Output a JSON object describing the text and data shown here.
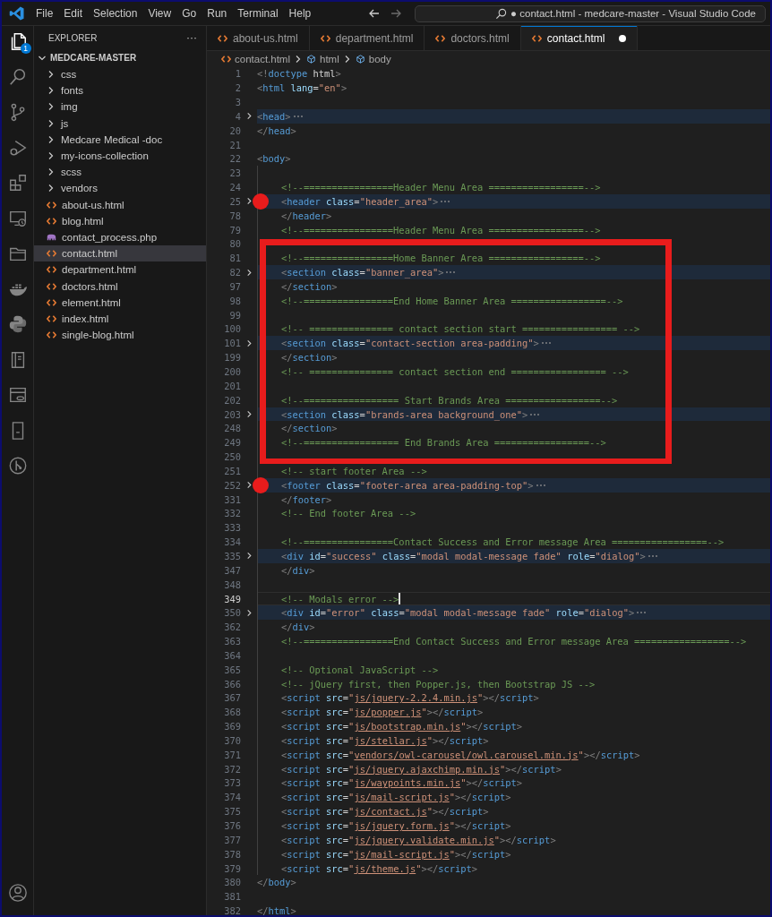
{
  "title_bar": {
    "menu": [
      "File",
      "Edit",
      "Selection",
      "View",
      "Go",
      "Run",
      "Terminal",
      "Help"
    ],
    "command_center": "● contact.html - medcare-master - Visual Studio Code"
  },
  "activity_bar": {
    "items": [
      {
        "kind": "explorer",
        "selected": true,
        "badge": "1"
      },
      {
        "kind": "search",
        "selected": false
      },
      {
        "kind": "source-control",
        "selected": false
      },
      {
        "kind": "run-debug",
        "selected": false
      },
      {
        "kind": "extensions",
        "selected": false
      },
      {
        "kind": "remote",
        "selected": false
      },
      {
        "kind": "folder",
        "selected": false
      },
      {
        "kind": "docker",
        "selected": false
      },
      {
        "kind": "python",
        "selected": false
      },
      {
        "kind": "book",
        "selected": false
      },
      {
        "kind": "database",
        "selected": false
      },
      {
        "kind": "bookmark",
        "selected": false
      },
      {
        "kind": "git-graph",
        "selected": false
      }
    ],
    "bottom": [
      {
        "kind": "account",
        "selected": false
      }
    ]
  },
  "sidebar": {
    "title": "EXPLORER",
    "more": "···",
    "root": {
      "label": "MEDCARE-MASTER",
      "expanded": true,
      "children": [
        {
          "kind": "folder",
          "label": "css",
          "expanded": false,
          "selected": false
        },
        {
          "kind": "folder",
          "label": "fonts",
          "expanded": false,
          "selected": false
        },
        {
          "kind": "folder",
          "label": "img",
          "expanded": false,
          "selected": false
        },
        {
          "kind": "folder",
          "label": "js",
          "expanded": false,
          "selected": false
        },
        {
          "kind": "folder",
          "label": "Medcare Medical -doc",
          "expanded": false,
          "selected": false
        },
        {
          "kind": "folder",
          "label": "my-icons-collection",
          "expanded": false,
          "selected": false
        },
        {
          "kind": "folder",
          "label": "scss",
          "expanded": false,
          "selected": false
        },
        {
          "kind": "folder",
          "label": "vendors",
          "expanded": false,
          "selected": false
        },
        {
          "kind": "html",
          "label": "about-us.html",
          "selected": false
        },
        {
          "kind": "html",
          "label": "blog.html",
          "selected": false
        },
        {
          "kind": "php",
          "label": "contact_process.php",
          "selected": false
        },
        {
          "kind": "html",
          "label": "contact.html",
          "selected": true
        },
        {
          "kind": "html",
          "label": "department.html",
          "selected": false
        },
        {
          "kind": "html",
          "label": "doctors.html",
          "selected": false
        },
        {
          "kind": "html",
          "label": "element.html",
          "selected": false
        },
        {
          "kind": "html",
          "label": "index.html",
          "selected": false
        },
        {
          "kind": "html",
          "label": "single-blog.html",
          "selected": false
        }
      ]
    }
  },
  "tabs": [
    {
      "label": "about-us.html",
      "selected": false,
      "modified": false
    },
    {
      "label": "department.html",
      "selected": false,
      "modified": false
    },
    {
      "label": "doctors.html",
      "selected": false,
      "modified": false
    },
    {
      "label": "contact.html",
      "selected": true,
      "modified": true
    }
  ],
  "breadcrumbs": [
    {
      "kind": "file",
      "label": "contact.html"
    },
    {
      "kind": "element",
      "label": "html"
    },
    {
      "kind": "element",
      "label": "body"
    }
  ],
  "editor": {
    "segments": [
      {
        "annotated": false,
        "lines": [
          {
            "number": "1",
            "indented": false,
            "folded": false,
            "tokens": [
              {
                "kind": "punct",
                "text": "<!"
              },
              {
                "kind": "tag",
                "text": "doctype"
              },
              {
                "kind": "plain",
                "text": " html"
              },
              {
                "kind": "punct",
                "text": ">"
              }
            ]
          },
          {
            "number": "2",
            "indented": false,
            "folded": false,
            "tokens": [
              {
                "kind": "punct",
                "text": "<"
              },
              {
                "kind": "tag",
                "text": "html"
              },
              {
                "kind": "attr",
                "text": " lang"
              },
              {
                "kind": "plain",
                "text": "="
              },
              {
                "kind": "string",
                "text": "\"en\""
              },
              {
                "kind": "punct",
                "text": ">"
              }
            ]
          },
          {
            "number": "3",
            "indented": false,
            "folded": false
          },
          {
            "number": "4",
            "indented": false,
            "folded": true,
            "tokens": [
              {
                "kind": "punct",
                "text": "<"
              },
              {
                "kind": "tag",
                "text": "head"
              },
              {
                "kind": "punct",
                "text": ">"
              }
            ]
          },
          {
            "number": "20",
            "indented": false,
            "folded": false,
            "tokens": [
              {
                "kind": "punct",
                "text": "</"
              },
              {
                "kind": "tag",
                "text": "head"
              },
              {
                "kind": "punct",
                "text": ">"
              }
            ]
          },
          {
            "number": "21",
            "indented": false,
            "folded": false
          },
          {
            "number": "22",
            "indented": false,
            "folded": false,
            "tokens": [
              {
                "kind": "punct",
                "text": "<"
              },
              {
                "kind": "tag",
                "text": "body"
              },
              {
                "kind": "punct",
                "text": ">"
              }
            ]
          },
          {
            "number": "23",
            "indented": true,
            "folded": false
          },
          {
            "number": "24",
            "indented": true,
            "folded": false,
            "tokens": [
              {
                "kind": "comment",
                "text": "<!--================Header Menu Area =================-->"
              }
            ]
          },
          {
            "number": "25",
            "indented": true,
            "folded": true,
            "breakpoint": true,
            "tokens": [
              {
                "kind": "punct",
                "text": "<"
              },
              {
                "kind": "tag",
                "text": "header"
              },
              {
                "kind": "attr",
                "text": " class"
              },
              {
                "kind": "plain",
                "text": "="
              },
              {
                "kind": "string",
                "text": "\"header_area\""
              },
              {
                "kind": "punct",
                "text": ">"
              }
            ]
          },
          {
            "number": "78",
            "indented": true,
            "folded": false,
            "tokens": [
              {
                "kind": "punct",
                "text": "</"
              },
              {
                "kind": "tag",
                "text": "header"
              },
              {
                "kind": "punct",
                "text": ">"
              }
            ]
          },
          {
            "number": "79",
            "indented": true,
            "folded": false,
            "tokens": [
              {
                "kind": "comment",
                "text": "<!--================Header Menu Area =================-->"
              }
            ]
          }
        ]
      },
      {
        "annotated": true,
        "lines": [
          {
            "number": "80",
            "indented": true,
            "folded": false
          },
          {
            "number": "81",
            "indented": true,
            "folded": false,
            "tokens": [
              {
                "kind": "comment",
                "text": "<!--================Home Banner Area =================-->"
              }
            ]
          },
          {
            "number": "82",
            "indented": true,
            "folded": true,
            "tokens": [
              {
                "kind": "punct",
                "text": "<"
              },
              {
                "kind": "tag",
                "text": "section"
              },
              {
                "kind": "attr",
                "text": " class"
              },
              {
                "kind": "plain",
                "text": "="
              },
              {
                "kind": "string",
                "text": "\"banner_area\""
              },
              {
                "kind": "punct",
                "text": ">"
              }
            ]
          },
          {
            "number": "97",
            "indented": true,
            "folded": false,
            "tokens": [
              {
                "kind": "punct",
                "text": "</"
              },
              {
                "kind": "tag",
                "text": "section"
              },
              {
                "kind": "punct",
                "text": ">"
              }
            ]
          },
          {
            "number": "98",
            "indented": true,
            "folded": false,
            "tokens": [
              {
                "kind": "comment",
                "text": "<!--================End Home Banner Area =================-->"
              }
            ]
          },
          {
            "number": "99",
            "indented": true,
            "folded": false
          },
          {
            "number": "100",
            "indented": true,
            "folded": false,
            "tokens": [
              {
                "kind": "comment",
                "text": "<!-- =============== contact section start ================= -->"
              }
            ]
          },
          {
            "number": "101",
            "indented": true,
            "folded": true,
            "tokens": [
              {
                "kind": "punct",
                "text": "<"
              },
              {
                "kind": "tag",
                "text": "section"
              },
              {
                "kind": "attr",
                "text": " class"
              },
              {
                "kind": "plain",
                "text": "="
              },
              {
                "kind": "string",
                "text": "\"contact-section area-padding\""
              },
              {
                "kind": "punct",
                "text": ">"
              }
            ]
          },
          {
            "number": "199",
            "indented": true,
            "folded": false,
            "tokens": [
              {
                "kind": "punct",
                "text": "</"
              },
              {
                "kind": "tag",
                "text": "section"
              },
              {
                "kind": "punct",
                "text": ">"
              }
            ]
          },
          {
            "number": "200",
            "indented": true,
            "folded": false,
            "tokens": [
              {
                "kind": "comment",
                "text": "<!-- =============== contact section end ================= -->"
              }
            ]
          },
          {
            "number": "201",
            "indented": true,
            "folded": false
          },
          {
            "number": "202",
            "indented": true,
            "folded": false,
            "tokens": [
              {
                "kind": "comment",
                "text": "<!--================= Start Brands Area =================-->"
              }
            ]
          },
          {
            "number": "203",
            "indented": true,
            "folded": true,
            "tokens": [
              {
                "kind": "punct",
                "text": "<"
              },
              {
                "kind": "tag",
                "text": "section"
              },
              {
                "kind": "attr",
                "text": " class"
              },
              {
                "kind": "plain",
                "text": "="
              },
              {
                "kind": "string",
                "text": "\"brands-area background_one\""
              },
              {
                "kind": "punct",
                "text": ">"
              }
            ]
          },
          {
            "number": "248",
            "indented": true,
            "folded": false,
            "tokens": [
              {
                "kind": "punct",
                "text": "</"
              },
              {
                "kind": "tag",
                "text": "section"
              },
              {
                "kind": "punct",
                "text": ">"
              }
            ]
          },
          {
            "number": "249",
            "indented": true,
            "folded": false,
            "tokens": [
              {
                "kind": "comment",
                "text": "<!--================= End Brands Area =================-->"
              }
            ]
          },
          {
            "number": "250",
            "indented": true,
            "folded": false
          }
        ]
      },
      {
        "annotated": false,
        "lines": [
          {
            "number": "251",
            "indented": true,
            "folded": false,
            "tokens": [
              {
                "kind": "comment",
                "text": "<!-- start footer Area -->"
              }
            ]
          },
          {
            "number": "252",
            "indented": true,
            "folded": true,
            "breakpoint": true,
            "tokens": [
              {
                "kind": "punct",
                "text": "<"
              },
              {
                "kind": "tag",
                "text": "footer"
              },
              {
                "kind": "attr",
                "text": " class"
              },
              {
                "kind": "plain",
                "text": "="
              },
              {
                "kind": "string",
                "text": "\"footer-area area-padding-top\""
              },
              {
                "kind": "punct",
                "text": ">"
              }
            ]
          },
          {
            "number": "331",
            "indented": true,
            "folded": false,
            "tokens": [
              {
                "kind": "punct",
                "text": "</"
              },
              {
                "kind": "tag",
                "text": "footer"
              },
              {
                "kind": "punct",
                "text": ">"
              }
            ]
          },
          {
            "number": "332",
            "indented": true,
            "folded": false,
            "tokens": [
              {
                "kind": "comment",
                "text": "<!-- End footer Area -->"
              }
            ]
          },
          {
            "number": "333",
            "indented": true,
            "folded": false
          },
          {
            "number": "334",
            "indented": true,
            "folded": false,
            "tokens": [
              {
                "kind": "comment",
                "text": "<!--================Contact Success and Error message Area =================-->"
              }
            ]
          },
          {
            "number": "335",
            "indented": true,
            "folded": true,
            "tokens": [
              {
                "kind": "punct",
                "text": "<"
              },
              {
                "kind": "tag",
                "text": "div"
              },
              {
                "kind": "attr",
                "text": " id"
              },
              {
                "kind": "plain",
                "text": "="
              },
              {
                "kind": "string",
                "text": "\"success\""
              },
              {
                "kind": "attr",
                "text": " class"
              },
              {
                "kind": "plain",
                "text": "="
              },
              {
                "kind": "string",
                "text": "\"modal modal-message fade\""
              },
              {
                "kind": "attr",
                "text": " role"
              },
              {
                "kind": "plain",
                "text": "="
              },
              {
                "kind": "string",
                "text": "\"dialog\""
              },
              {
                "kind": "punct",
                "text": ">"
              }
            ]
          },
          {
            "number": "347",
            "indented": true,
            "folded": false,
            "tokens": [
              {
                "kind": "punct",
                "text": "</"
              },
              {
                "kind": "tag",
                "text": "div"
              },
              {
                "kind": "punct",
                "text": ">"
              }
            ]
          },
          {
            "number": "348",
            "indented": true,
            "folded": false
          },
          {
            "number": "349",
            "indented": true,
            "folded": false,
            "current": true,
            "tokens": [
              {
                "kind": "comment",
                "text": "<!-- Modals error -->"
              }
            ]
          },
          {
            "number": "350",
            "indented": true,
            "folded": true,
            "tokens": [
              {
                "kind": "punct",
                "text": "<"
              },
              {
                "kind": "tag",
                "text": "div"
              },
              {
                "kind": "attr",
                "text": " id"
              },
              {
                "kind": "plain",
                "text": "="
              },
              {
                "kind": "string",
                "text": "\"error\""
              },
              {
                "kind": "attr",
                "text": " class"
              },
              {
                "kind": "plain",
                "text": "="
              },
              {
                "kind": "string",
                "text": "\"modal modal-message fade\""
              },
              {
                "kind": "attr",
                "text": " role"
              },
              {
                "kind": "plain",
                "text": "="
              },
              {
                "kind": "string",
                "text": "\"dialog\""
              },
              {
                "kind": "punct",
                "text": ">"
              }
            ]
          },
          {
            "number": "362",
            "indented": true,
            "folded": false,
            "tokens": [
              {
                "kind": "punct",
                "text": "</"
              },
              {
                "kind": "tag",
                "text": "div"
              },
              {
                "kind": "punct",
                "text": ">"
              }
            ]
          },
          {
            "number": "363",
            "indented": true,
            "folded": false,
            "tokens": [
              {
                "kind": "comment",
                "text": "<!--================End Contact Success and Error message Area =================-->"
              }
            ]
          },
          {
            "number": "364",
            "indented": true,
            "folded": false
          },
          {
            "number": "365",
            "indented": true,
            "folded": false,
            "tokens": [
              {
                "kind": "comment",
                "text": "<!-- Optional JavaScript -->"
              }
            ]
          },
          {
            "number": "366",
            "indented": true,
            "folded": false,
            "tokens": [
              {
                "kind": "comment",
                "text": "<!-- jQuery first, then Popper.js, then Bootstrap JS -->"
              }
            ]
          },
          {
            "number": "367",
            "indented": true,
            "folded": false,
            "tokens": [
              {
                "kind": "punct",
                "text": "<"
              },
              {
                "kind": "tag",
                "text": "script"
              },
              {
                "kind": "attr",
                "text": " src"
              },
              {
                "kind": "plain",
                "text": "="
              },
              {
                "kind": "string",
                "text": "\""
              },
              {
                "kind": "link",
                "text": "js/jquery-2.2.4.min.js"
              },
              {
                "kind": "string",
                "text": "\""
              },
              {
                "kind": "punct",
                "text": "></"
              },
              {
                "kind": "tag",
                "text": "script"
              },
              {
                "kind": "punct",
                "text": ">"
              }
            ]
          },
          {
            "number": "368",
            "indented": true,
            "folded": false,
            "tokens": [
              {
                "kind": "punct",
                "text": "<"
              },
              {
                "kind": "tag",
                "text": "script"
              },
              {
                "kind": "attr",
                "text": " src"
              },
              {
                "kind": "plain",
                "text": "="
              },
              {
                "kind": "string",
                "text": "\""
              },
              {
                "kind": "link",
                "text": "js/popper.js"
              },
              {
                "kind": "string",
                "text": "\""
              },
              {
                "kind": "punct",
                "text": "></"
              },
              {
                "kind": "tag",
                "text": "script"
              },
              {
                "kind": "punct",
                "text": ">"
              }
            ]
          },
          {
            "number": "369",
            "indented": true,
            "folded": false,
            "tokens": [
              {
                "kind": "punct",
                "text": "<"
              },
              {
                "kind": "tag",
                "text": "script"
              },
              {
                "kind": "attr",
                "text": " src"
              },
              {
                "kind": "plain",
                "text": "="
              },
              {
                "kind": "string",
                "text": "\""
              },
              {
                "kind": "link",
                "text": "js/bootstrap.min.js"
              },
              {
                "kind": "string",
                "text": "\""
              },
              {
                "kind": "punct",
                "text": "></"
              },
              {
                "kind": "tag",
                "text": "script"
              },
              {
                "kind": "punct",
                "text": ">"
              }
            ]
          },
          {
            "number": "370",
            "indented": true,
            "folded": false,
            "tokens": [
              {
                "kind": "punct",
                "text": "<"
              },
              {
                "kind": "tag",
                "text": "script"
              },
              {
                "kind": "attr",
                "text": " src"
              },
              {
                "kind": "plain",
                "text": "="
              },
              {
                "kind": "string",
                "text": "\""
              },
              {
                "kind": "link",
                "text": "js/stellar.js"
              },
              {
                "kind": "string",
                "text": "\""
              },
              {
                "kind": "punct",
                "text": "></"
              },
              {
                "kind": "tag",
                "text": "script"
              },
              {
                "kind": "punct",
                "text": ">"
              }
            ]
          },
          {
            "number": "371",
            "indented": true,
            "folded": false,
            "tokens": [
              {
                "kind": "punct",
                "text": "<"
              },
              {
                "kind": "tag",
                "text": "script"
              },
              {
                "kind": "attr",
                "text": " src"
              },
              {
                "kind": "plain",
                "text": "="
              },
              {
                "kind": "string",
                "text": "\""
              },
              {
                "kind": "link",
                "text": "vendors/owl-carousel/owl.carousel.min.js"
              },
              {
                "kind": "string",
                "text": "\""
              },
              {
                "kind": "punct",
                "text": "></"
              },
              {
                "kind": "tag",
                "text": "script"
              },
              {
                "kind": "punct",
                "text": ">"
              }
            ]
          },
          {
            "number": "372",
            "indented": true,
            "folded": false,
            "tokens": [
              {
                "kind": "punct",
                "text": "<"
              },
              {
                "kind": "tag",
                "text": "script"
              },
              {
                "kind": "attr",
                "text": " src"
              },
              {
                "kind": "plain",
                "text": "="
              },
              {
                "kind": "string",
                "text": "\""
              },
              {
                "kind": "link",
                "text": "js/jquery.ajaxchimp.min.js"
              },
              {
                "kind": "string",
                "text": "\""
              },
              {
                "kind": "punct",
                "text": "></"
              },
              {
                "kind": "tag",
                "text": "script"
              },
              {
                "kind": "punct",
                "text": ">"
              }
            ]
          },
          {
            "number": "373",
            "indented": true,
            "folded": false,
            "tokens": [
              {
                "kind": "punct",
                "text": "<"
              },
              {
                "kind": "tag",
                "text": "script"
              },
              {
                "kind": "attr",
                "text": " src"
              },
              {
                "kind": "plain",
                "text": "="
              },
              {
                "kind": "string",
                "text": "\""
              },
              {
                "kind": "link",
                "text": "js/waypoints.min.js"
              },
              {
                "kind": "string",
                "text": "\""
              },
              {
                "kind": "punct",
                "text": "></"
              },
              {
                "kind": "tag",
                "text": "script"
              },
              {
                "kind": "punct",
                "text": ">"
              }
            ]
          },
          {
            "number": "374",
            "indented": true,
            "folded": false,
            "tokens": [
              {
                "kind": "punct",
                "text": "<"
              },
              {
                "kind": "tag",
                "text": "script"
              },
              {
                "kind": "attr",
                "text": " src"
              },
              {
                "kind": "plain",
                "text": "="
              },
              {
                "kind": "string",
                "text": "\""
              },
              {
                "kind": "link",
                "text": "js/mail-script.js"
              },
              {
                "kind": "string",
                "text": "\""
              },
              {
                "kind": "punct",
                "text": "></"
              },
              {
                "kind": "tag",
                "text": "script"
              },
              {
                "kind": "punct",
                "text": ">"
              }
            ]
          },
          {
            "number": "375",
            "indented": true,
            "folded": false,
            "tokens": [
              {
                "kind": "punct",
                "text": "<"
              },
              {
                "kind": "tag",
                "text": "script"
              },
              {
                "kind": "attr",
                "text": " src"
              },
              {
                "kind": "plain",
                "text": "="
              },
              {
                "kind": "string",
                "text": "\""
              },
              {
                "kind": "link",
                "text": "js/contact.js"
              },
              {
                "kind": "string",
                "text": "\""
              },
              {
                "kind": "punct",
                "text": "></"
              },
              {
                "kind": "tag",
                "text": "script"
              },
              {
                "kind": "punct",
                "text": ">"
              }
            ]
          },
          {
            "number": "376",
            "indented": true,
            "folded": false,
            "tokens": [
              {
                "kind": "punct",
                "text": "<"
              },
              {
                "kind": "tag",
                "text": "script"
              },
              {
                "kind": "attr",
                "text": " src"
              },
              {
                "kind": "plain",
                "text": "="
              },
              {
                "kind": "string",
                "text": "\""
              },
              {
                "kind": "link",
                "text": "js/jquery.form.js"
              },
              {
                "kind": "string",
                "text": "\""
              },
              {
                "kind": "punct",
                "text": "></"
              },
              {
                "kind": "tag",
                "text": "script"
              },
              {
                "kind": "punct",
                "text": ">"
              }
            ]
          },
          {
            "number": "377",
            "indented": true,
            "folded": false,
            "tokens": [
              {
                "kind": "punct",
                "text": "<"
              },
              {
                "kind": "tag",
                "text": "script"
              },
              {
                "kind": "attr",
                "text": " src"
              },
              {
                "kind": "plain",
                "text": "="
              },
              {
                "kind": "string",
                "text": "\""
              },
              {
                "kind": "link",
                "text": "js/jquery.validate.min.js"
              },
              {
                "kind": "string",
                "text": "\""
              },
              {
                "kind": "punct",
                "text": "></"
              },
              {
                "kind": "tag",
                "text": "script"
              },
              {
                "kind": "punct",
                "text": ">"
              }
            ]
          },
          {
            "number": "378",
            "indented": true,
            "folded": false,
            "tokens": [
              {
                "kind": "punct",
                "text": "<"
              },
              {
                "kind": "tag",
                "text": "script"
              },
              {
                "kind": "attr",
                "text": " src"
              },
              {
                "kind": "plain",
                "text": "="
              },
              {
                "kind": "string",
                "text": "\""
              },
              {
                "kind": "link",
                "text": "js/mail-script.js"
              },
              {
                "kind": "string",
                "text": "\""
              },
              {
                "kind": "punct",
                "text": "></"
              },
              {
                "kind": "tag",
                "text": "script"
              },
              {
                "kind": "punct",
                "text": ">"
              }
            ]
          },
          {
            "number": "379",
            "indented": true,
            "folded": false,
            "tokens": [
              {
                "kind": "punct",
                "text": "<"
              },
              {
                "kind": "tag",
                "text": "script"
              },
              {
                "kind": "attr",
                "text": " src"
              },
              {
                "kind": "plain",
                "text": "="
              },
              {
                "kind": "string",
                "text": "\""
              },
              {
                "kind": "link",
                "text": "js/theme.js"
              },
              {
                "kind": "string",
                "text": "\""
              },
              {
                "kind": "punct",
                "text": "></"
              },
              {
                "kind": "tag",
                "text": "script"
              },
              {
                "kind": "punct",
                "text": ">"
              }
            ]
          },
          {
            "number": "380",
            "indented": false,
            "folded": false,
            "tokens": [
              {
                "kind": "punct",
                "text": "</"
              },
              {
                "kind": "tag",
                "text": "body"
              },
              {
                "kind": "punct",
                "text": ">"
              }
            ]
          },
          {
            "number": "381",
            "indented": false,
            "folded": false
          },
          {
            "number": "382",
            "indented": false,
            "folded": false,
            "tokens": [
              {
                "kind": "punct",
                "text": "</"
              },
              {
                "kind": "tag",
                "text": "html"
              },
              {
                "kind": "punct",
                "text": ">"
              }
            ]
          }
        ]
      }
    ]
  }
}
